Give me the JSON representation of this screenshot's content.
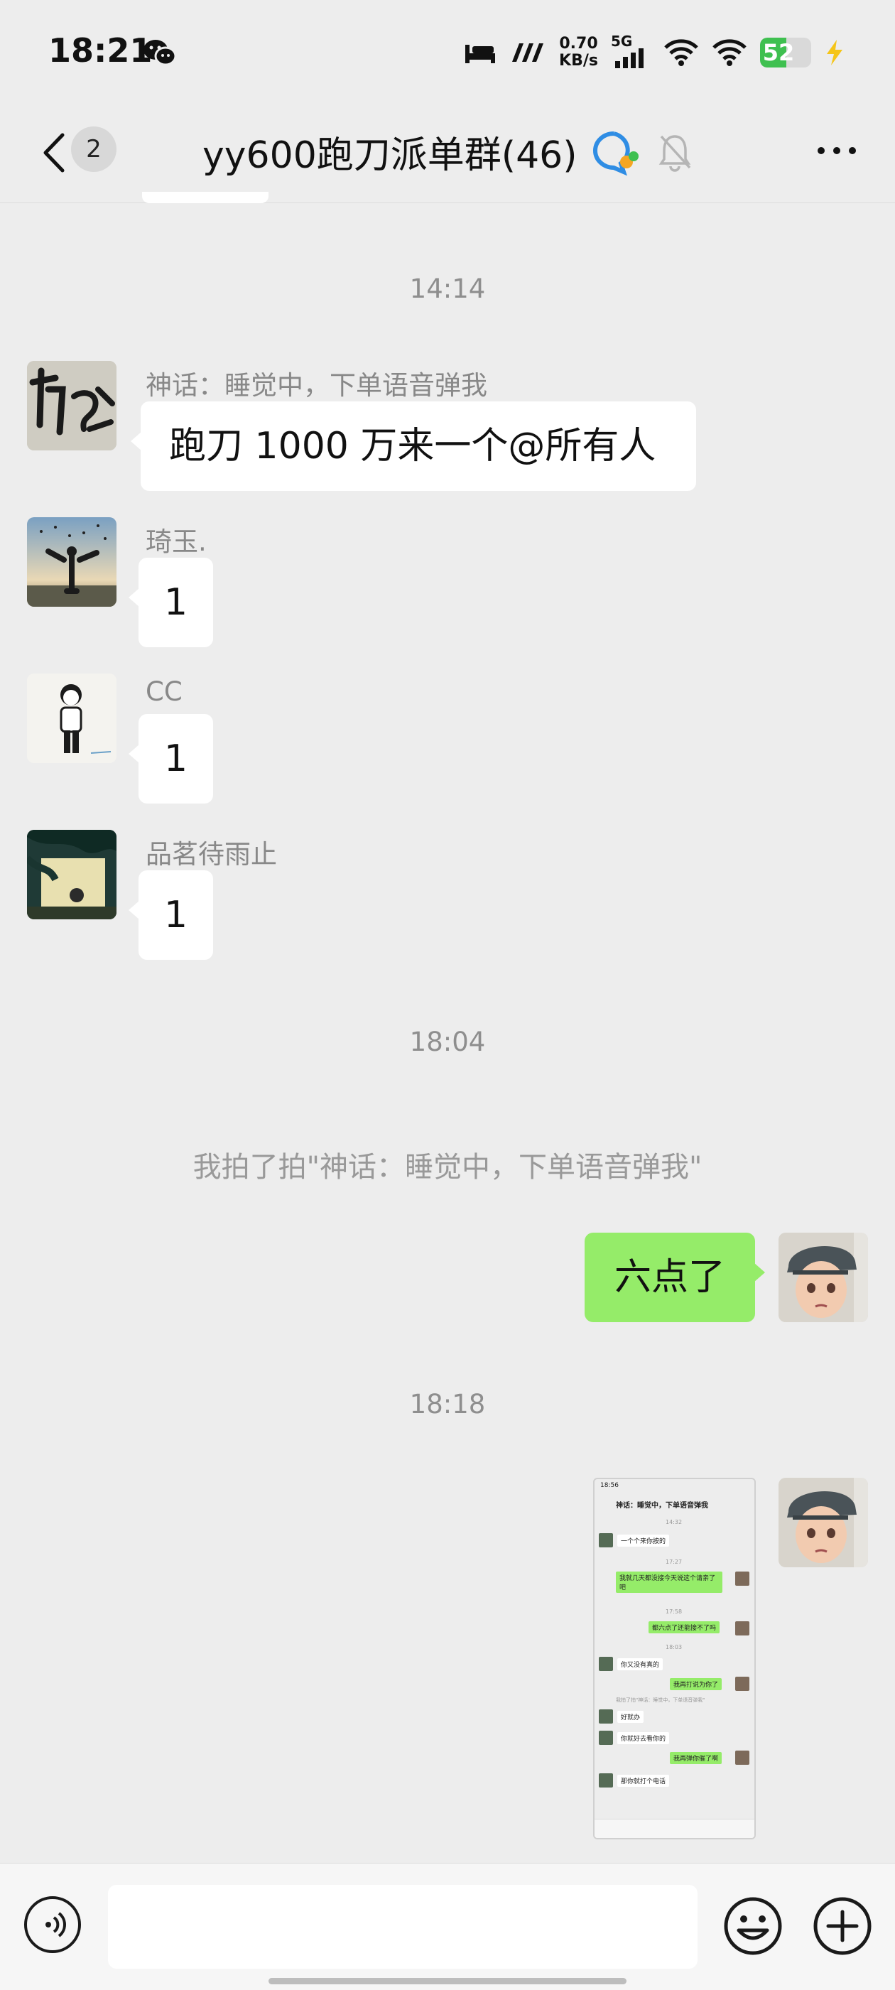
{
  "status_bar": {
    "time": "18:21",
    "net_speed_value": "0.70",
    "net_speed_unit": "KB/s",
    "signal_label": "5G",
    "battery": "52",
    "battery_level": 0.52
  },
  "nav": {
    "back_count": "2",
    "title": "yy600跑刀派单群(46)"
  },
  "timestamps": [
    "14:14",
    "18:04",
    "18:18"
  ],
  "messages": [
    {
      "sender": "神话：睡觉中，下单语音弹我",
      "text": "跑刀 1000 万来一个@所有人"
    },
    {
      "sender": "琦玉.",
      "text": "1"
    },
    {
      "sender": "CC",
      "text": "1"
    },
    {
      "sender": "品茗待雨止",
      "text": "1"
    }
  ],
  "system_message": "我拍了拍\"神话：睡觉中，下单语音弹我\"",
  "my_messages": [
    {
      "text": "六点了"
    }
  ],
  "thumbnail": {
    "time": "18:56",
    "title": "神话：睡觉中，下单语音弹我",
    "lines": [
      "14:32",
      "一个个来你按的",
      "17:27",
      "我就几天都没接今天说这个请亲了吧",
      "17:58",
      "都六点了还能接不了吗",
      "18:03",
      "你又没有真的",
      "我再打说为你了",
      "我拍了拍\"神话：睡觉中，下单语音弹我\"",
      "好就办",
      "你就好去看你的",
      "我再弹你催了啊",
      "那你就打个电话"
    ]
  },
  "input": {
    "placeholder": ""
  },
  "colors": {
    "background": "#ededed",
    "my_bubble": "#95ec69",
    "other_bubble": "#ffffff",
    "battery": "#3fc050"
  }
}
